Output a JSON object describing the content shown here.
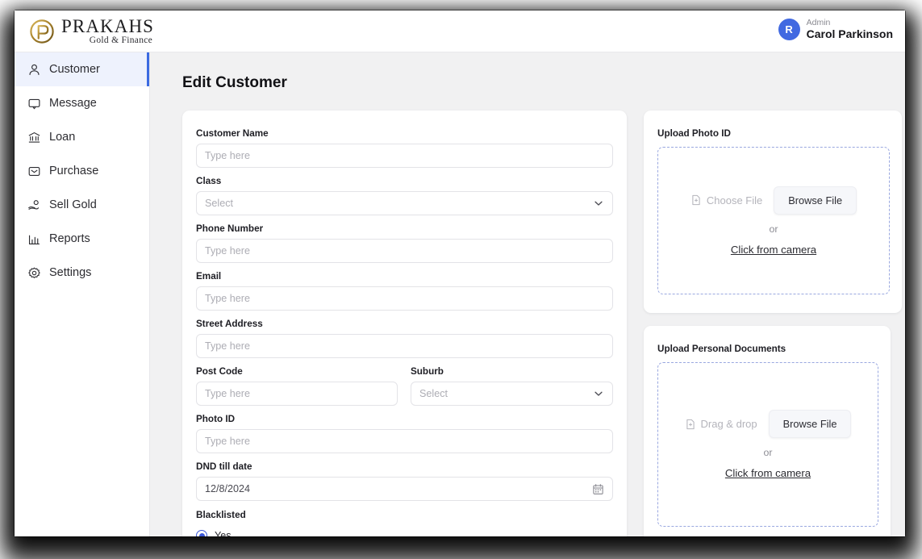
{
  "header": {
    "logo_name": "PRAKAHS",
    "logo_tagline": "Gold & Finance",
    "logo_icon": "prakahs-gold-p-emblem",
    "user_role": "Admin",
    "user_name": "Carol Parkinson",
    "avatar_initial": "R",
    "avatar_color": "#4169e1"
  },
  "sidebar": {
    "items": [
      {
        "label": "Customer",
        "icon": "user-icon",
        "active": true
      },
      {
        "label": "Message",
        "icon": "chat-bubble-icon",
        "active": false
      },
      {
        "label": "Loan",
        "icon": "bank-icon",
        "active": false
      },
      {
        "label": "Purchase",
        "icon": "inbox-icon",
        "active": false
      },
      {
        "label": "Sell Gold",
        "icon": "hand-coin-icon",
        "active": false
      },
      {
        "label": "Reports",
        "icon": "bar-chart-icon",
        "active": false
      },
      {
        "label": "Settings",
        "icon": "gear-icon",
        "active": false
      }
    ],
    "active_accent_color": "#3b6ae1",
    "active_bg_color": "#eef2fd"
  },
  "main": {
    "page_title": "Edit Customer",
    "form": {
      "customer_name": {
        "label": "Customer Name",
        "placeholder": "Type here",
        "value": ""
      },
      "class": {
        "label": "Class",
        "placeholder": "Select",
        "value": "",
        "type": "select"
      },
      "phone_number": {
        "label": "Phone Number",
        "placeholder": "Type here",
        "value": ""
      },
      "email": {
        "label": "Email",
        "placeholder": "Type here",
        "value": ""
      },
      "street_address": {
        "label": "Street Address",
        "placeholder": "Type here",
        "value": ""
      },
      "post_code": {
        "label": "Post Code",
        "placeholder": "Type here",
        "value": ""
      },
      "suburb": {
        "label": "Suburb",
        "placeholder": "Select",
        "value": "",
        "type": "select"
      },
      "photo_id": {
        "label": "Photo ID",
        "placeholder": "Type here",
        "value": ""
      },
      "dnd_till_date": {
        "label": "DND till date",
        "value": "12/8/2024",
        "icon": "calendar-icon"
      },
      "blacklisted": {
        "label": "Blacklisted",
        "option_yes": "Yes",
        "selected": "Yes",
        "radio_color": "#3b57d8"
      }
    }
  },
  "upload_photo": {
    "title": "Upload Photo ID",
    "choose_label": "Choose File",
    "choose_icon": "file-plus-icon",
    "browse_label": "Browse File",
    "or_label": "or",
    "camera_label": "Click from camera",
    "border_color": "#9aa8e0"
  },
  "upload_docs": {
    "title": "Upload Personal Documents",
    "choose_label": "Drag & drop",
    "choose_icon": "file-plus-icon",
    "browse_label": "Browse File",
    "or_label": "or",
    "camera_label": "Click from camera",
    "border_color": "#9aa8e0"
  }
}
